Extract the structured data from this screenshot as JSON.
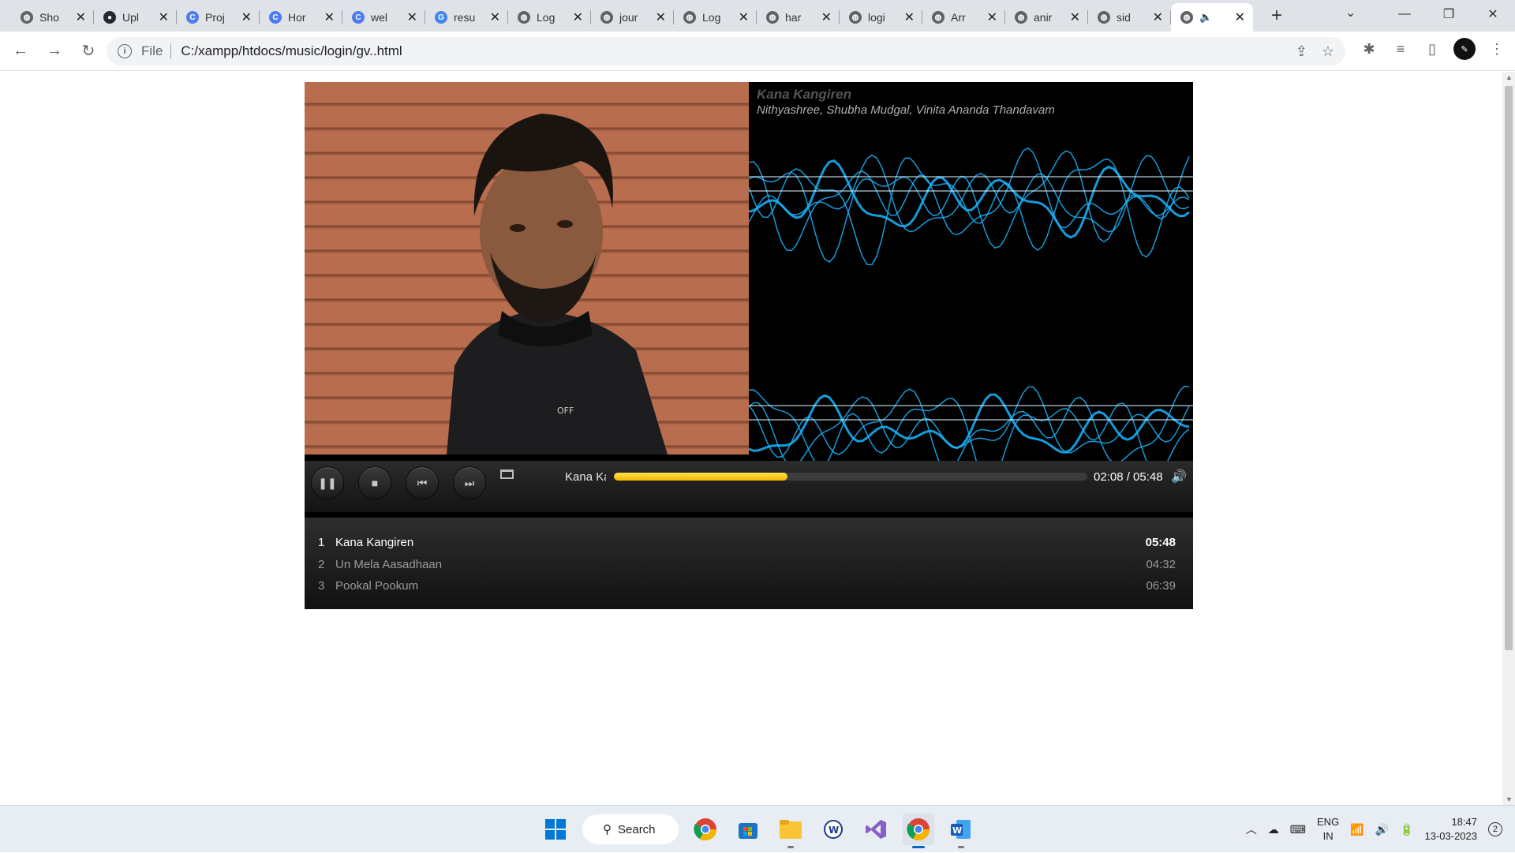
{
  "browser": {
    "tabs": [
      {
        "title": "Sho",
        "icon": "globe-icon"
      },
      {
        "title": "Upl",
        "icon": "github-icon"
      },
      {
        "title": "Proj",
        "icon": "canva-icon"
      },
      {
        "title": "Hor",
        "icon": "canva-icon"
      },
      {
        "title": "wel",
        "icon": "canva-icon"
      },
      {
        "title": "resu",
        "icon": "google-icon"
      },
      {
        "title": "Log",
        "icon": "globe-icon"
      },
      {
        "title": "jour",
        "icon": "globe-icon"
      },
      {
        "title": "Log",
        "icon": "globe-icon"
      },
      {
        "title": "har",
        "icon": "globe-icon"
      },
      {
        "title": "logi",
        "icon": "globe-icon"
      },
      {
        "title": "Arr",
        "icon": "globe-icon"
      },
      {
        "title": "anir",
        "icon": "globe-icon"
      },
      {
        "title": "sid",
        "icon": "globe-icon"
      }
    ],
    "active_tab": {
      "icon": "globe-icon",
      "audio_icon": "speaker-icon"
    },
    "address": {
      "scheme_label": "File",
      "url": "C:/xampp/htdocs/music/login/gv..html"
    }
  },
  "player": {
    "track_title": "Kana Kangiren",
    "track_artists": "Nithyashree, Shubha Mudgal, Vinita Ananda Thandavam",
    "now_playing_marquee": "Kana Kangiren",
    "time_display": "02:08 / 05:48",
    "progress_fraction": 0.366,
    "playlist": [
      {
        "num": "1",
        "name": "Kana Kangiren",
        "duration": "05:48",
        "current": true
      },
      {
        "num": "2",
        "name": "Un Mela Aasadhaan",
        "duration": "04:32",
        "current": false
      },
      {
        "num": "3",
        "name": "Pookal Pookum",
        "duration": "06:39",
        "current": false
      }
    ],
    "colors": {
      "progress": "#f5c400",
      "wave": "#19b6ff"
    }
  },
  "taskbar": {
    "search_label": "Search",
    "lang_line1": "ENG",
    "lang_line2": "IN",
    "time": "18:47",
    "date": "13-03-2023",
    "notifications": "2"
  }
}
